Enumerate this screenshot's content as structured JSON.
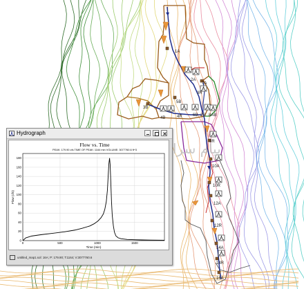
{
  "map": {
    "node_labels": [
      "1A",
      "2A",
      "3B",
      "4B",
      "5B",
      "6B",
      "4R",
      "2R",
      "3R",
      "7A",
      "8AB",
      "8R",
      "10A",
      "10R",
      "12A",
      "12R",
      "14A",
      "14R",
      "16A"
    ],
    "watermark": "پیام سرا",
    "colors": {
      "contour_scale": [
        "#2f6d2a",
        "#3f8f3a",
        "#6aae5a",
        "#9ccc6e",
        "#c2dc84",
        "#e2d87a",
        "#e9b86e",
        "#e69c7a",
        "#ea8ea2",
        "#d48ad6",
        "#9d9ae6",
        "#7ab8ea",
        "#66d0dc",
        "#5ad0c8"
      ],
      "routing_line": "#1f2d8c",
      "subbasin_brown": "#9a5a1a",
      "subbasin_purple": "#8a2a9a",
      "subbasin_green": "#2a8a2a",
      "subbasin_red": "#c01818",
      "arrow": "#e8953a"
    }
  },
  "hydrograph_window": {
    "title": "Hydrograph",
    "app_icon": "hydrograph-icon",
    "buttons": [
      "minimize-icon",
      "maximize-icon",
      "close-icon"
    ],
    "status_icon": "print-icon",
    "status": "untitled_map1.sol: 16A; P: 179.90; T:1164; V:3077760.6"
  },
  "chart_data": {
    "type": "line",
    "title": "Flow vs. Time",
    "subtitle": "PEAK: 179.90 cfs  TIME OF PEAK: 1164 min  VOLUME: 3077760.6 ft^3",
    "xlabel": "Time (min)",
    "ylabel": "Flow (cfs)",
    "xlim": [
      0,
      1900
    ],
    "ylim": [
      0,
      190
    ],
    "xticks": [
      0,
      500,
      1000,
      1500
    ],
    "yticks": [
      0,
      20,
      40,
      60,
      80,
      100,
      120,
      140,
      160,
      180
    ],
    "grid": true,
    "series": [
      {
        "color": "#000000",
        "x": [
          0,
          40,
          120,
          250,
          400,
          550,
          700,
          800,
          900,
          960,
          1010,
          1050,
          1080,
          1100,
          1120,
          1135,
          1145,
          1155,
          1164,
          1172,
          1180,
          1190,
          1200,
          1215,
          1230,
          1250,
          1280,
          1320,
          1400,
          1500,
          1600,
          1700,
          1800,
          1900
        ],
        "y": [
          0,
          6,
          10,
          13,
          16,
          19,
          23,
          27,
          32,
          37,
          43,
          50,
          58,
          68,
          85,
          110,
          140,
          168,
          179.9,
          165,
          130,
          85,
          55,
          32,
          18,
          10,
          6,
          4,
          2.5,
          2,
          1.5,
          1.2,
          1,
          0.8
        ]
      }
    ]
  }
}
